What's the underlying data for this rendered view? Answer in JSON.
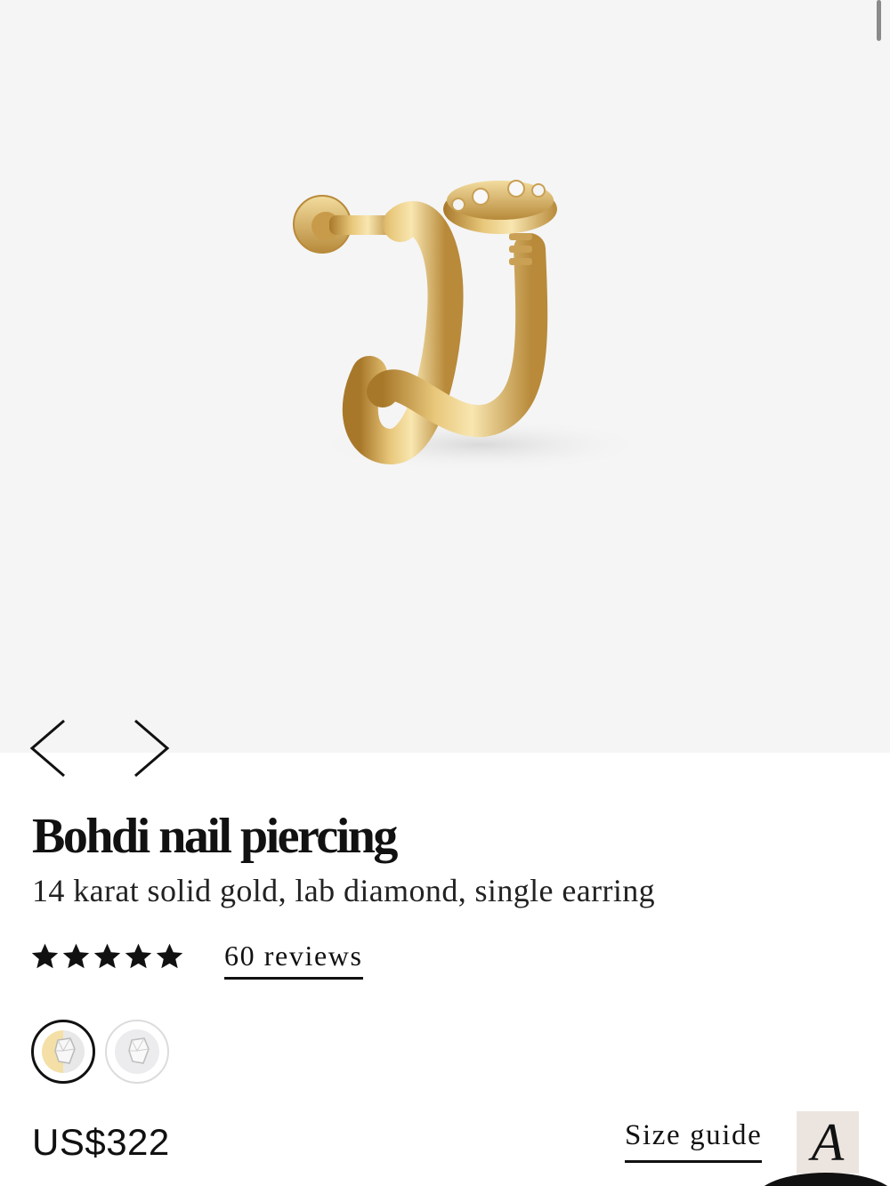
{
  "product": {
    "title": "Bohdi nail piercing",
    "subtitle": "14 karat solid gold, lab diamond, single earring",
    "rating": 5,
    "rating_max": 5,
    "reviews_label": "60 reviews",
    "price": "US$322",
    "size_guide_label": "Size guide",
    "image_icon": "gold-nail-piercing-image"
  },
  "gallery": {
    "prev_icon": "chevron-left-icon",
    "next_icon": "chevron-right-icon"
  },
  "variants": [
    {
      "name": "yellow-gold",
      "selected": true,
      "color": "#f4dfa6"
    },
    {
      "name": "white-gold",
      "selected": false,
      "color": "#e9e9ea"
    }
  ],
  "brand_badge": {
    "letter": "A",
    "background": "#ece5df"
  },
  "colors": {
    "gallery_bg": "#f5f5f5",
    "text": "#111111"
  }
}
